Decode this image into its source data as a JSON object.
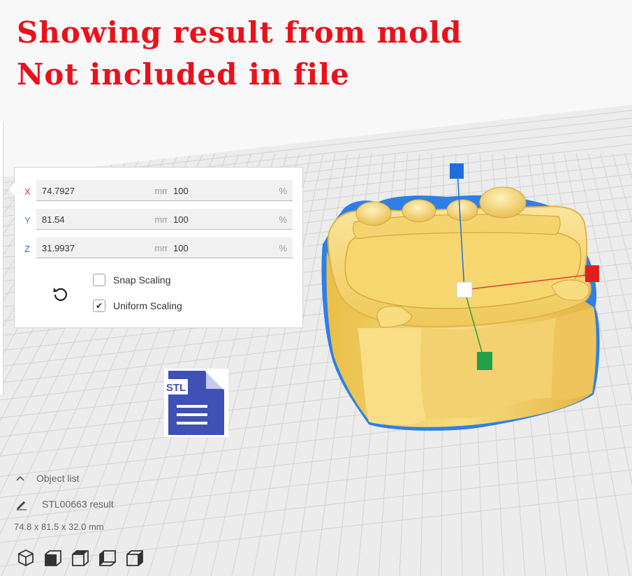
{
  "banner": {
    "line1": "Showing result from mold",
    "line2": "Not included in file",
    "color": "#e8121c"
  },
  "scale_panel": {
    "rows": [
      {
        "axis": "X",
        "axis_color": "#e53935",
        "size": "74.7927",
        "size_unit": "mm",
        "percent": "100",
        "percent_unit": "%"
      },
      {
        "axis": "Y",
        "axis_color": "#43a047",
        "size": "81.54",
        "size_unit": "mm",
        "percent": "100",
        "percent_unit": "%"
      },
      {
        "axis": "Z",
        "axis_color": "#1e6fd9",
        "size": "31.9937",
        "size_unit": "mm",
        "percent": "100",
        "percent_unit": "%"
      }
    ],
    "snap_scaling": {
      "label": "Snap Scaling",
      "checked": false
    },
    "uniform_scaling": {
      "label": "Uniform Scaling",
      "checked": true,
      "mark": "✔"
    },
    "reset_icon": "rotate-ccw-icon"
  },
  "file_badge": {
    "label": "STL",
    "color": "#3f51b5"
  },
  "object_list": {
    "header": "Object list",
    "header_icon": "chevron-up-icon",
    "object_name": "STL00663 result",
    "object_icon": "pencil-icon",
    "dimensions": "74.8 x 81.5 x 32.0 mm"
  },
  "view_buttons": [
    "3d-view-icon",
    "front-view-icon",
    "top-view-icon",
    "left-view-icon",
    "right-view-icon"
  ],
  "model": {
    "fill": "#f7d778",
    "outline": "#2f7fe6"
  }
}
